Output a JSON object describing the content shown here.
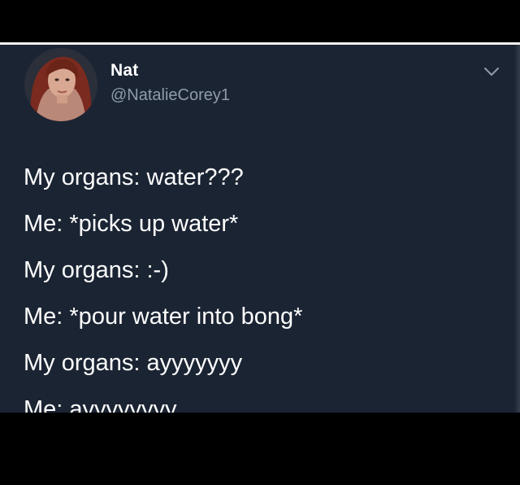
{
  "header": {
    "display_name": "Nat",
    "handle": "@NatalieCorey1"
  },
  "icons": {
    "avatar": "profile-photo",
    "menu": "chevron-down-icon"
  },
  "tweet": {
    "lines": [
      "My organs: water???",
      "Me: *picks up water*",
      "My organs: :-)",
      "Me: *pour water into bong*",
      "My organs: ayyyyyyy",
      "Me: ayyyyyyyy"
    ]
  },
  "colors": {
    "card_background": "#1b2433",
    "name_text": "#ffffff",
    "handle_text": "#8f9bab",
    "body_text": "#ffffff"
  }
}
